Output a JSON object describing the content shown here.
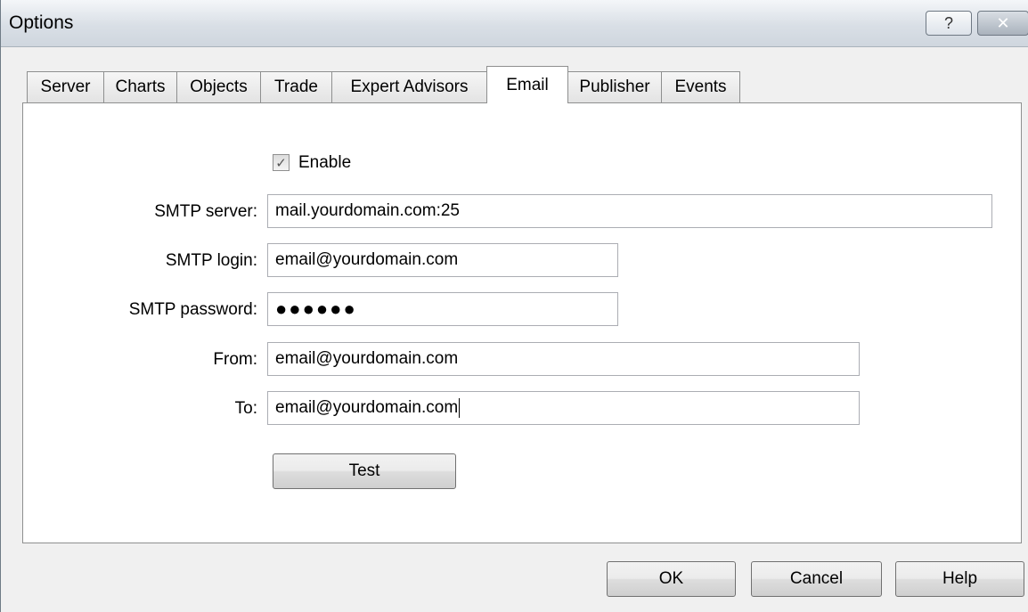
{
  "window": {
    "title": "Options",
    "help_label": "?",
    "close_label": "✕"
  },
  "tabs": [
    {
      "label": "Server"
    },
    {
      "label": "Charts"
    },
    {
      "label": "Objects"
    },
    {
      "label": "Trade"
    },
    {
      "label": "Expert Advisors"
    },
    {
      "label": "Email",
      "active": true
    },
    {
      "label": "Publisher"
    },
    {
      "label": "Events"
    }
  ],
  "email": {
    "enable_label": "Enable",
    "enable_checked": true,
    "enable_mark": "✓",
    "smtp_server_label": "SMTP server:",
    "smtp_server_value": "mail.yourdomain.com:25",
    "smtp_login_label": "SMTP login:",
    "smtp_login_value": "email@yourdomain.com",
    "smtp_password_label": "SMTP password:",
    "smtp_password_value": "●●●●●●",
    "from_label": "From:",
    "from_value": "email@yourdomain.com",
    "to_label": "To:",
    "to_value": "email@yourdomain.com",
    "test_label": "Test"
  },
  "footer": {
    "ok_label": "OK",
    "cancel_label": "Cancel",
    "help_label": "Help"
  }
}
